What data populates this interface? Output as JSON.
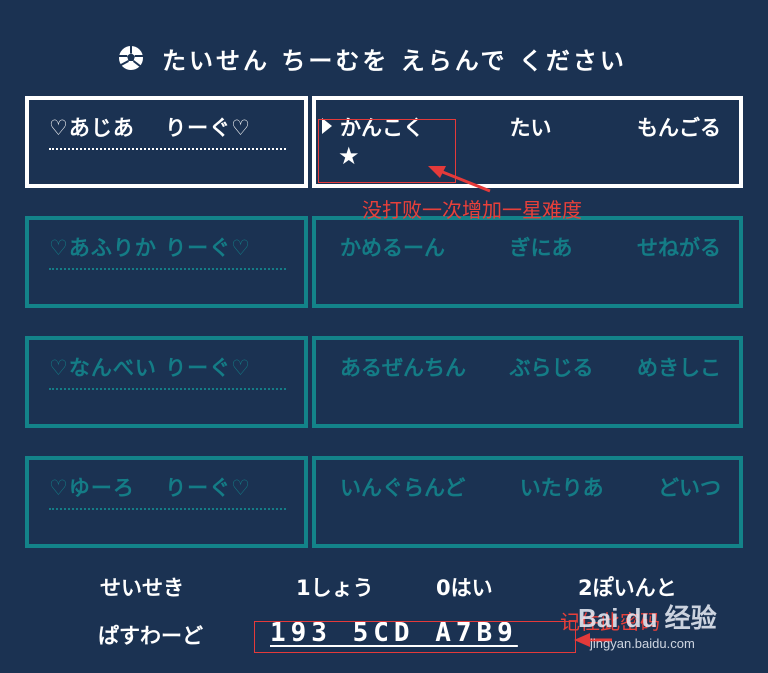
{
  "title": "たいせん ちーむを えらんで ください",
  "leagues": [
    {
      "name": "♡あじあ　 りーぐ♡",
      "teams": [
        "かんこく",
        "たい",
        "もんごる"
      ],
      "active": true,
      "stars": "★"
    },
    {
      "name": "♡あふりか りーぐ♡",
      "teams": [
        "かめるーん",
        "ぎにあ",
        "せねがる"
      ],
      "active": false
    },
    {
      "name": "♡なんべい りーぐ♡",
      "teams": [
        "あるぜんちん",
        "ぶらじる",
        "めきしこ"
      ],
      "active": false
    },
    {
      "name": "♡ゆーろ　 りーぐ♡",
      "teams": [
        "いんぐらんど",
        "いたりあ",
        "どいつ"
      ],
      "active": false
    }
  ],
  "record": {
    "label": "せいせき",
    "wins": "1しょう",
    "losses": "0はい",
    "points": "2ぽいんと"
  },
  "password": {
    "label": "ぱすわーど",
    "value": "193 5CD A7B9"
  },
  "annotations": {
    "star_note": "没打败一次增加一星难度",
    "password_note": "记住此密码"
  },
  "watermark": {
    "logo": "Bai du 经验",
    "url": "jingyan.baidu.com"
  },
  "colors": {
    "background": "#1b3252",
    "inactive": "#138389",
    "annotation": "#e8403a"
  }
}
